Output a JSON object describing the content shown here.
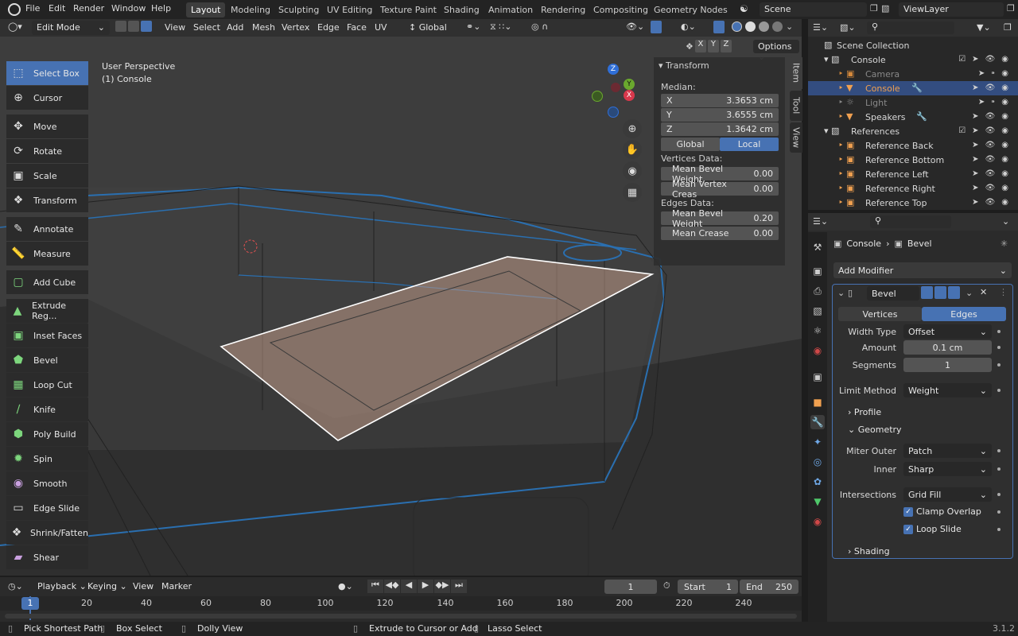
{
  "menus": [
    "File",
    "Edit",
    "Render",
    "Window",
    "Help"
  ],
  "workspaces": [
    "Layout",
    "Modeling",
    "Sculpting",
    "UV Editing",
    "Texture Paint",
    "Shading",
    "Animation",
    "Rendering",
    "Compositing",
    "Geometry Nodes"
  ],
  "scene": "Scene",
  "view_layer": "ViewLayer",
  "viewport_header": {
    "mode": "Edit Mode",
    "menus": [
      "View",
      "Select",
      "Add",
      "Mesh",
      "Vertex",
      "Edge",
      "Face",
      "UV"
    ],
    "orientation": "Global",
    "axes": [
      "X",
      "Y",
      "Z"
    ],
    "options": "Options"
  },
  "viewport": {
    "perspective": "User Perspective",
    "object": "(1) Console",
    "gizmo_axes": [
      "Z",
      "Y",
      "X"
    ]
  },
  "tools": [
    {
      "label": "Select Box",
      "icon": "select-box-icon"
    },
    {
      "label": "Cursor",
      "icon": "cursor-icon"
    },
    {
      "label": "Move",
      "icon": "move-icon"
    },
    {
      "label": "Rotate",
      "icon": "rotate-icon"
    },
    {
      "label": "Scale",
      "icon": "scale-icon"
    },
    {
      "label": "Transform",
      "icon": "transform-icon"
    },
    {
      "label": "Annotate",
      "icon": "annotate-icon"
    },
    {
      "label": "Measure",
      "icon": "measure-icon"
    },
    {
      "label": "Add Cube",
      "icon": "add-cube-icon"
    },
    {
      "label": "Extrude Reg...",
      "icon": "extrude-icon"
    },
    {
      "label": "Inset Faces",
      "icon": "inset-icon"
    },
    {
      "label": "Bevel",
      "icon": "bevel-icon"
    },
    {
      "label": "Loop Cut",
      "icon": "loop-cut-icon"
    },
    {
      "label": "Knife",
      "icon": "knife-icon"
    },
    {
      "label": "Poly Build",
      "icon": "poly-build-icon"
    },
    {
      "label": "Spin",
      "icon": "spin-icon"
    },
    {
      "label": "Smooth",
      "icon": "smooth-icon"
    },
    {
      "label": "Edge Slide",
      "icon": "edge-slide-icon"
    },
    {
      "label": "Shrink/Fatten",
      "icon": "shrink-fatten-icon"
    },
    {
      "label": "Shear",
      "icon": "shear-icon"
    }
  ],
  "transform_panel": {
    "title": "Transform",
    "median_label": "Median:",
    "x": {
      "label": "X",
      "value": "3.3653 cm"
    },
    "y": {
      "label": "Y",
      "value": "3.6555 cm"
    },
    "z": {
      "label": "Z",
      "value": "1.3642 cm"
    },
    "global": "Global",
    "local": "Local",
    "vertices_label": "Vertices Data:",
    "mean_bevel_weight_v": {
      "label": "Mean Bevel Weight",
      "value": "0.00"
    },
    "mean_vertex_crease": {
      "label": "Mean Vertex Creas",
      "value": "0.00"
    },
    "edges_label": "Edges Data:",
    "mean_bevel_weight_e": {
      "label": "Mean Bevel Weight",
      "value": "0.20"
    },
    "mean_crease": {
      "label": "Mean Crease",
      "value": "0.00"
    }
  },
  "side_tabs": [
    "Item",
    "Tool",
    "View"
  ],
  "outliner": {
    "rows": [
      {
        "label": "Scene Collection",
        "indent": 0
      },
      {
        "label": "Console",
        "indent": 1
      },
      {
        "label": "Camera",
        "indent": 2
      },
      {
        "label": "Console",
        "indent": 2
      },
      {
        "label": "Light",
        "indent": 2
      },
      {
        "label": "Speakers",
        "indent": 2
      },
      {
        "label": "References",
        "indent": 1
      },
      {
        "label": "Reference Back",
        "indent": 2
      },
      {
        "label": "Reference Bottom",
        "indent": 2
      },
      {
        "label": "Reference Left",
        "indent": 2
      },
      {
        "label": "Reference Right",
        "indent": 2
      },
      {
        "label": "Reference Top",
        "indent": 2
      }
    ]
  },
  "properties": {
    "breadcrumb_object": "Console",
    "breadcrumb_modifier": "Bevel",
    "add_modifier": "Add Modifier",
    "modifier_name": "Bevel",
    "tab_vertices": "Vertices",
    "tab_edges": "Edges",
    "width_type": {
      "label": "Width Type",
      "value": "Offset"
    },
    "amount": {
      "label": "Amount",
      "value": "0.1 cm"
    },
    "segments": {
      "label": "Segments",
      "value": "1"
    },
    "limit_method": {
      "label": "Limit Method",
      "value": "Weight"
    },
    "profile": "Profile",
    "geometry": "Geometry",
    "miter_outer": {
      "label": "Miter Outer",
      "value": "Patch"
    },
    "inner": {
      "label": "Inner",
      "value": "Sharp"
    },
    "intersections": {
      "label": "Intersections",
      "value": "Grid Fill"
    },
    "clamp_overlap": "Clamp Overlap",
    "loop_slide": "Loop Slide",
    "shading": "Shading"
  },
  "timeline": {
    "playback": "Playback",
    "keying": "Keying",
    "view": "View",
    "marker": "Marker",
    "current_frame": "1",
    "start_label": "Start",
    "start": "1",
    "end_label": "End",
    "end": "250",
    "ticks": [
      "1",
      "20",
      "40",
      "60",
      "80",
      "100",
      "120",
      "140",
      "160",
      "180",
      "200",
      "220",
      "240"
    ]
  },
  "status": {
    "pick_shortest_path": "Pick Shortest Path",
    "box_select": "Box Select",
    "dolly_view": "Dolly View",
    "extrude_to_cursor": "Extrude to Cursor or Add",
    "lasso_select": "Lasso Select",
    "version": "3.1.2"
  },
  "colors": {
    "accent": "#4772b3",
    "selected_face": "#c09a88",
    "wire": "#2a6fb0"
  }
}
